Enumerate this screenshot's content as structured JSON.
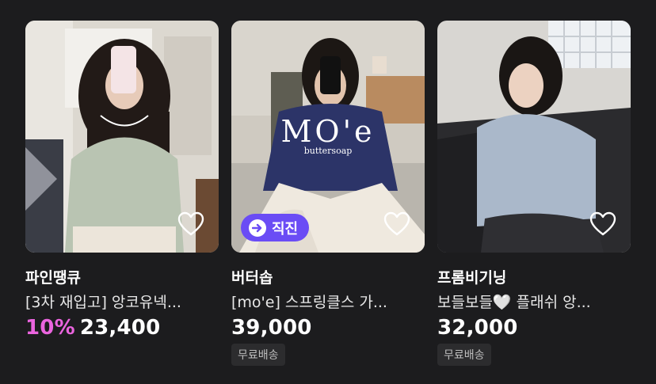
{
  "products": [
    {
      "brand": "파인땡큐",
      "title": "[3차 재입고] 앙코유넥...",
      "discount": "10%",
      "price": "23,400",
      "tag": ""
    },
    {
      "brand": "버터솝",
      "title": "[mo'e] 스프링클스 가...",
      "discount": "",
      "price": "39,000",
      "tag": "무료배송",
      "badge": "직진",
      "image_logo": "MO'e",
      "image_logo_sub": "buttersoap"
    },
    {
      "brand": "프롬비기닝",
      "title": "보들보들🤍 플래쉬 앙...",
      "discount": "",
      "price": "32,000",
      "tag": "무료배송"
    }
  ],
  "colors": {
    "background": "#1c1c1e",
    "discount": "#ea64de",
    "badge": "#6a4cf5",
    "tag_bg": "#2c2c2e"
  },
  "icons": [
    "heart-outline-icon",
    "arrow-right-circle-icon"
  ]
}
